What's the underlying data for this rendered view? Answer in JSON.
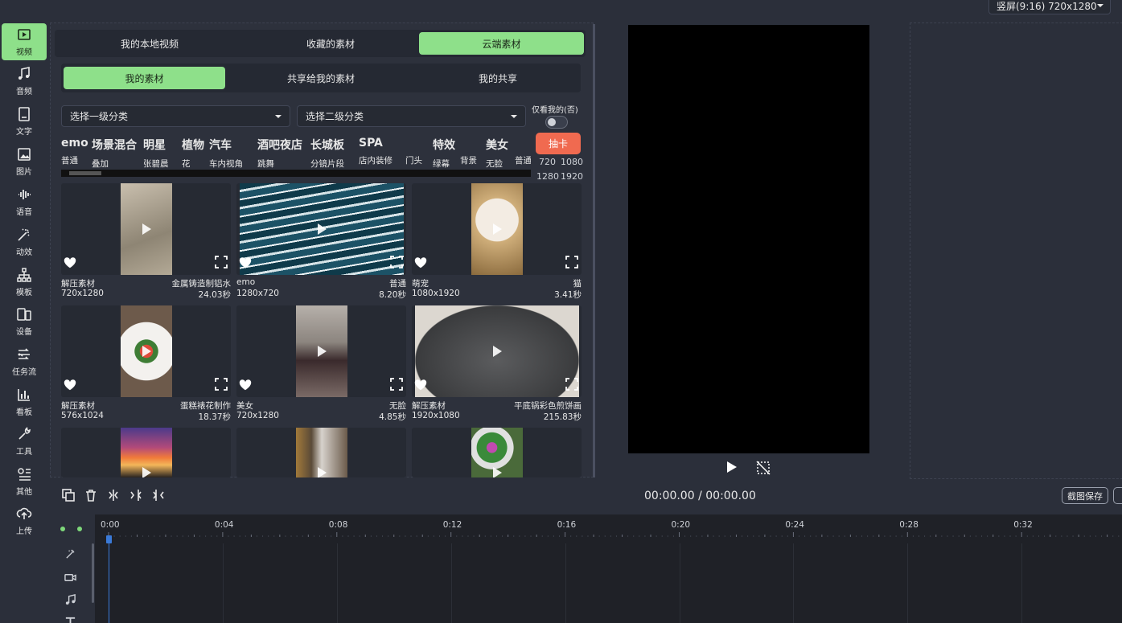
{
  "nav": {
    "items": [
      {
        "label": "视频",
        "icon": "video-icon",
        "active": true
      },
      {
        "label": "音频",
        "icon": "music-note-icon"
      },
      {
        "label": "文字",
        "icon": "text-icon"
      },
      {
        "label": "图片",
        "icon": "image-icon"
      },
      {
        "label": "语音",
        "icon": "waveform-icon"
      },
      {
        "label": "动效",
        "icon": "magic-wand-icon"
      },
      {
        "label": "模板",
        "icon": "template-icon"
      },
      {
        "label": "设备",
        "icon": "device-icon"
      },
      {
        "label": "任务流",
        "icon": "workflow-icon"
      },
      {
        "label": "看板",
        "icon": "bar-chart-icon"
      },
      {
        "label": "工具",
        "icon": "wrench-icon"
      },
      {
        "label": "其他",
        "icon": "more-icon"
      },
      {
        "label": "上传",
        "icon": "upload-icon"
      }
    ]
  },
  "top_tabs": [
    "我的本地视频",
    "收藏的素材",
    "云端素材"
  ],
  "top_tab_active": "云端素材",
  "sub_tabs": [
    "我的素材",
    "共享给我的素材",
    "我的共享"
  ],
  "sub_tab_active": "我的素材",
  "filters": {
    "level1": "选择一级分类",
    "level2": "选择二级分类",
    "only_mine": "仅看我的(否)"
  },
  "tags": [
    {
      "big": "emo",
      "small": "普通"
    },
    {
      "big": "场景混合",
      "small": "叠加"
    },
    {
      "big": "明星",
      "small": "张碧晨"
    },
    {
      "big": "植物",
      "small": "花"
    },
    {
      "big": "汽车",
      "small": "车内视角"
    },
    {
      "big": "酒吧夜店",
      "small": "跳舞"
    },
    {
      "big": "长城板",
      "small": "分镜片段"
    },
    {
      "big": "SPA",
      "small": "店内装修"
    },
    {
      "big": "",
      "small": "门头"
    },
    {
      "big": "特效",
      "small": "绿幕"
    },
    {
      "big": "",
      "small": "背景"
    },
    {
      "big": "美女",
      "small": "无脸"
    },
    {
      "big": "",
      "small": "普通"
    }
  ],
  "draw_card_label": "抽卡",
  "resolutions": [
    "720",
    "1080",
    "1280",
    "1920"
  ],
  "cards": [
    {
      "tag": "解压素材",
      "title": "金属铸造制铝水",
      "res": "720x1280",
      "dur": "24.03秒",
      "thumb": "sand"
    },
    {
      "tag": "emo",
      "title": "普通",
      "res": "1280x720",
      "dur": "8.20秒",
      "thumb": "water"
    },
    {
      "tag": "萌宠",
      "title": "猫",
      "res": "1080x1920",
      "dur": "3.41秒",
      "thumb": "cat"
    },
    {
      "tag": "解压素材",
      "title": "蛋糕裱花制作",
      "res": "576x1024",
      "dur": "18.37秒",
      "thumb": "cake"
    },
    {
      "tag": "美女",
      "title": "无脸",
      "res": "720x1280",
      "dur": "4.85秒",
      "thumb": "girl"
    },
    {
      "tag": "解压素材",
      "title": "平底锅彩色煎饼画",
      "res": "1920x1080",
      "dur": "215.83秒",
      "thumb": "pan"
    },
    {
      "tag": "",
      "title": "",
      "res": "",
      "dur": "",
      "thumb": "sunset"
    },
    {
      "tag": "",
      "title": "",
      "res": "",
      "dur": "",
      "thumb": "kitten"
    },
    {
      "tag": "",
      "title": "",
      "res": "",
      "dur": "",
      "thumb": "flowers"
    }
  ],
  "ratio": "竖屏(9:16) 720x1280",
  "time": {
    "current": "00:00.00",
    "sep": "/",
    "total": "00:00.00"
  },
  "save_label": "截图保存",
  "ticks": [
    "0:00",
    "0:04",
    "0:08",
    "0:12",
    "0:16",
    "0:20",
    "0:24",
    "0:28",
    "0:32"
  ],
  "colors": {
    "accent": "#8ee08a",
    "draw_button": "#f06a50",
    "playhead": "#3a7ad8"
  }
}
